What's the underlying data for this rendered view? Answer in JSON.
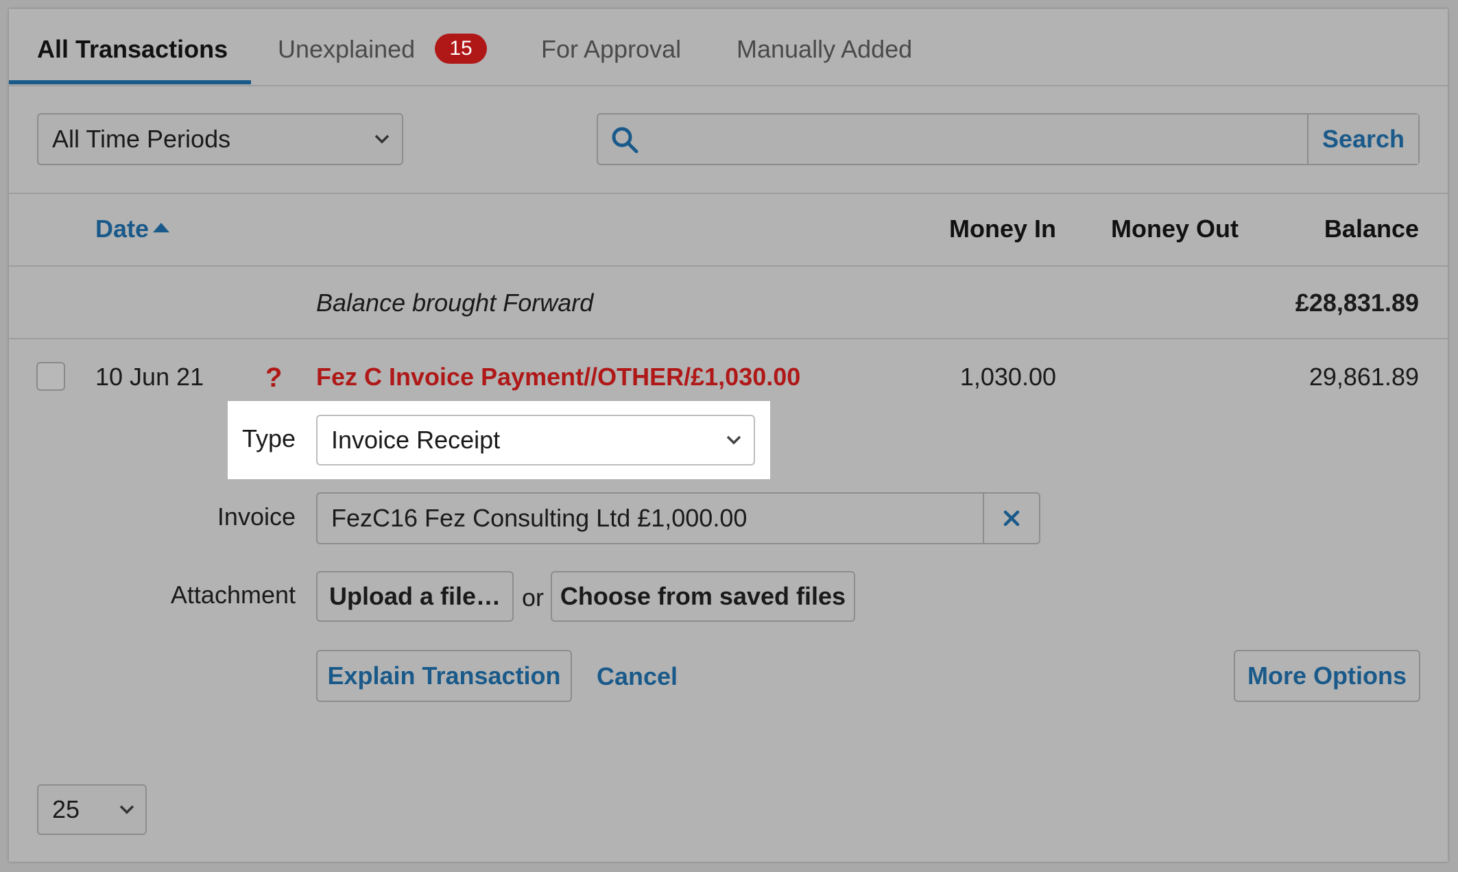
{
  "tabs": [
    {
      "label": "All Transactions"
    },
    {
      "label": "Unexplained",
      "badge": "15"
    },
    {
      "label": "For Approval"
    },
    {
      "label": "Manually Added"
    }
  ],
  "filters": {
    "period_value": "All Time Periods",
    "search_placeholder": "",
    "search_button": "Search"
  },
  "columns": {
    "date": "Date",
    "money_in": "Money In",
    "money_out": "Money Out",
    "balance": "Balance"
  },
  "balance_forward": {
    "label": "Balance brought Forward",
    "balance": "£28,831.89"
  },
  "transaction": {
    "date": "10 Jun 21",
    "status_icon": "?",
    "description": "Fez C Invoice Payment//OTHER/£1,030.00",
    "money_in": "1,030.00",
    "balance": "29,861.89"
  },
  "explain_form": {
    "type_label": "Type",
    "type_value": "Invoice Receipt",
    "invoice_label": "Invoice",
    "invoice_value": "FezC16 Fez Consulting Ltd £1,000.00",
    "attachment_label": "Attachment",
    "upload_button": "Upload a file…",
    "or_text": "or",
    "choose_button": "Choose from saved files",
    "explain_button": "Explain Transaction",
    "cancel_link": "Cancel",
    "more_options_button": "More Options"
  },
  "pagination": {
    "per_page": "25"
  },
  "colors": {
    "accent": "#1a5a8a",
    "alert": "#b01818",
    "background": "#b3b3b3"
  }
}
